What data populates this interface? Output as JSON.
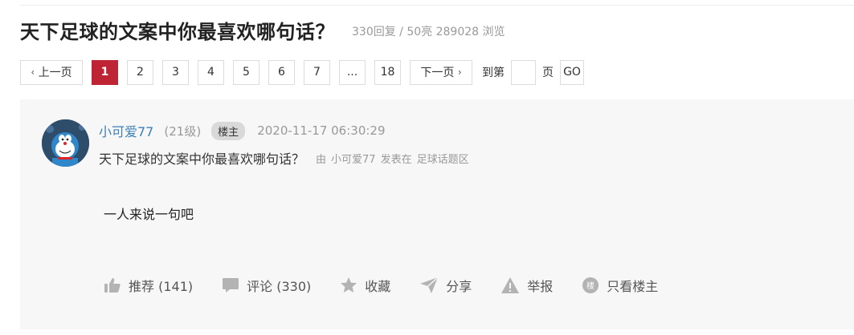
{
  "header": {
    "title": "天下足球的文案中你最喜欢哪句话？",
    "stats": "330回复 / 50亮 289028 浏览"
  },
  "pager": {
    "prev": "上一页",
    "pages": [
      "1",
      "2",
      "3",
      "4",
      "5",
      "6",
      "7",
      "...",
      "18"
    ],
    "current": "1",
    "next": "下一页",
    "goto_prefix": "到第",
    "goto_suffix": "页",
    "go": "GO",
    "accent_color": "#bf2434"
  },
  "post": {
    "username": "小可爱77",
    "level": "(21级)",
    "badge": "楼主",
    "date": "2020-11-17 06:30:29",
    "title": "天下足球的文案中你最喜欢哪句话？",
    "by": "由",
    "author": "小可爱77",
    "posted_in": "发表在",
    "forum": "足球话题区",
    "body": "一人来说一句吧",
    "avatar_icon": "doraemon-avatar"
  },
  "actions": {
    "recommend": "推荐 (141)",
    "comment": "评论 (330)",
    "favorite": "收藏",
    "share": "分享",
    "report": "举报",
    "owner_only": "只看楼主"
  }
}
